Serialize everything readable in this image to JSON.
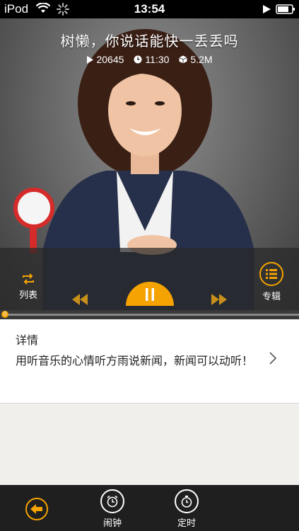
{
  "status_bar": {
    "carrier": "iPod",
    "time": "13:54"
  },
  "player": {
    "title": "树懒，你说话能快一丢丢吗",
    "plays": "20645",
    "duration": "11:30",
    "size": "5.2M",
    "list_label": "列表",
    "album_label": "专辑",
    "progress_value": "0",
    "progress_fraction": 0.0
  },
  "details": {
    "heading": "详情",
    "description": "用听音乐的心情听方雨说新闻，新闻可以动听！"
  },
  "toolbar": {
    "alarm_label": "闹钟",
    "timer_label": "定时"
  },
  "colors": {
    "accent": "#f5a300",
    "bar": "#1f1f1f"
  }
}
